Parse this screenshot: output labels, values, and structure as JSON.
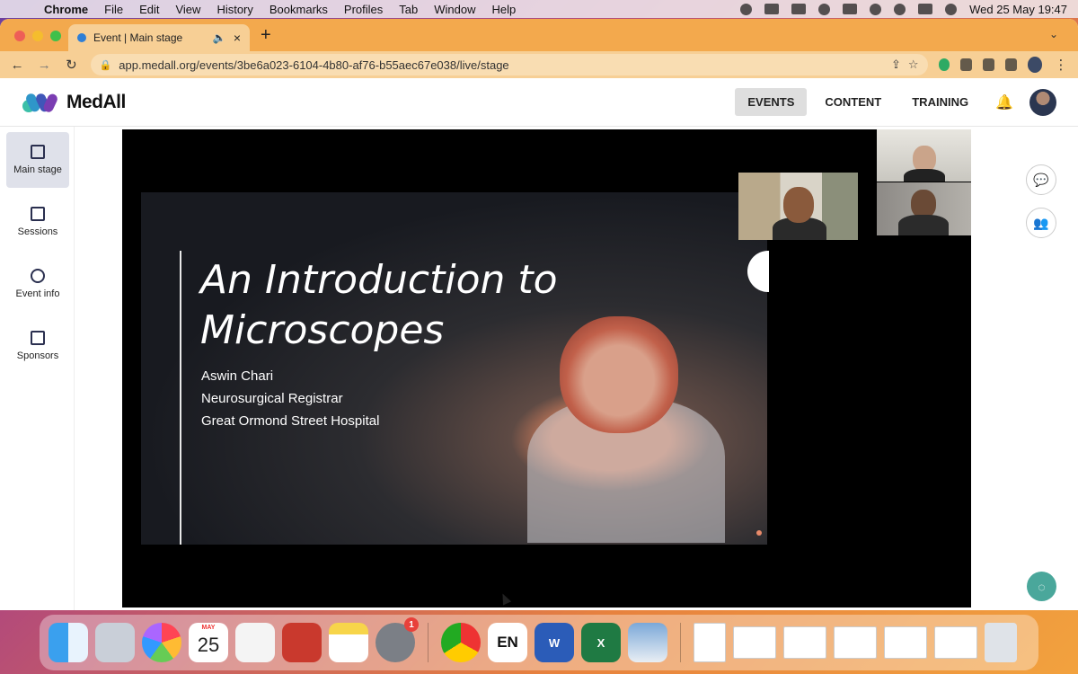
{
  "menubar": {
    "app": "Chrome",
    "items": [
      "File",
      "Edit",
      "View",
      "History",
      "Bookmarks",
      "Profiles",
      "Tab",
      "Window",
      "Help"
    ],
    "clock": "Wed 25 May  19:47"
  },
  "browser": {
    "tab_title": "Event | Main stage",
    "url": "app.medall.org/events/3be6a023-6104-4b80-af76-b55aec67e038/live/stage"
  },
  "app": {
    "brand": "MedAll",
    "nav": [
      "EVENTS",
      "CONTENT",
      "TRAINING"
    ],
    "active_nav": "EVENTS"
  },
  "sidebar": {
    "items": [
      {
        "label": "Main stage",
        "icon": "tv-icon"
      },
      {
        "label": "Sessions",
        "icon": "calendar-icon"
      },
      {
        "label": "Event info",
        "icon": "info-icon"
      },
      {
        "label": "Sponsors",
        "icon": "calendar-icon"
      }
    ]
  },
  "slide": {
    "title_line1": "An Introduction to",
    "title_line2": "Microscopes",
    "presenter": "Aswin Chari",
    "role": "Neurosurgical Registrar",
    "hospital": "Great Ormond Street Hospital"
  },
  "dock": {
    "calendar_month": "MAY",
    "calendar_day": "25",
    "settings_badge": "1",
    "en_label": "EN"
  },
  "colors": {
    "tab_bar": "#f3a94d",
    "toolbar": "#f7cf95",
    "brand_teal": "#4aa79b",
    "sidebar_active": "#dfe1ea"
  }
}
